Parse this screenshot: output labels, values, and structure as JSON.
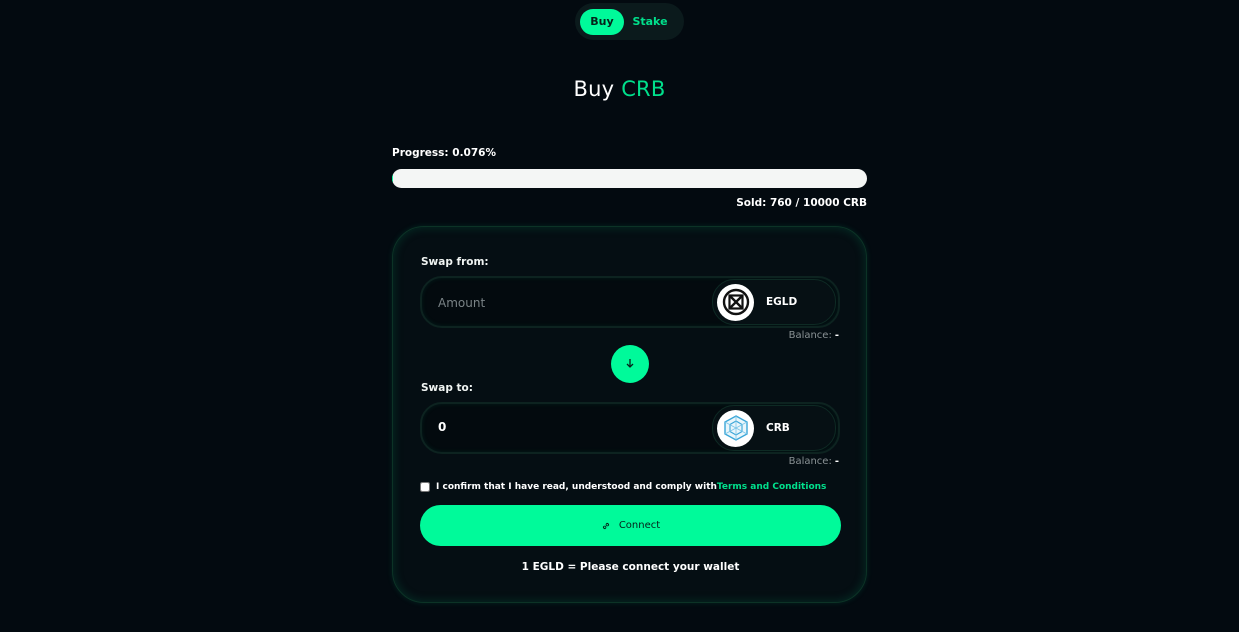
{
  "toggle": {
    "buy_label": "Buy",
    "stake_label": "Stake",
    "active": "Buy"
  },
  "title": {
    "prefix": "Buy",
    "token": "CRB"
  },
  "progress": {
    "label": "Progress: 0.076%",
    "fraction": 0.076,
    "sold_text": "Sold: 760 / 10000 CRB"
  },
  "swap_from": {
    "label": "Swap from:",
    "placeholder": "Amount",
    "value": "",
    "token": "EGLD",
    "token_icon": "egld-logo-icon",
    "balance_label": "Balance:",
    "balance_value": "-"
  },
  "swap_to": {
    "label": "Swap to:",
    "value": "0",
    "token": "CRB",
    "token_icon": "crb-logo-icon",
    "balance_label": "Balance:",
    "balance_value": "-"
  },
  "confirm": {
    "text": "I confirm that I have read, understood and comply with",
    "link_text": "Terms and Conditions",
    "checked": false
  },
  "connect_button": {
    "label": "Connect",
    "icon": "link-icon"
  },
  "rate_text": "1 EGLD = Please connect your wallet",
  "colors": {
    "background": "#030a10",
    "accent": "#00fa9a",
    "accent_text": "#00e08c",
    "card": "#050e13"
  }
}
